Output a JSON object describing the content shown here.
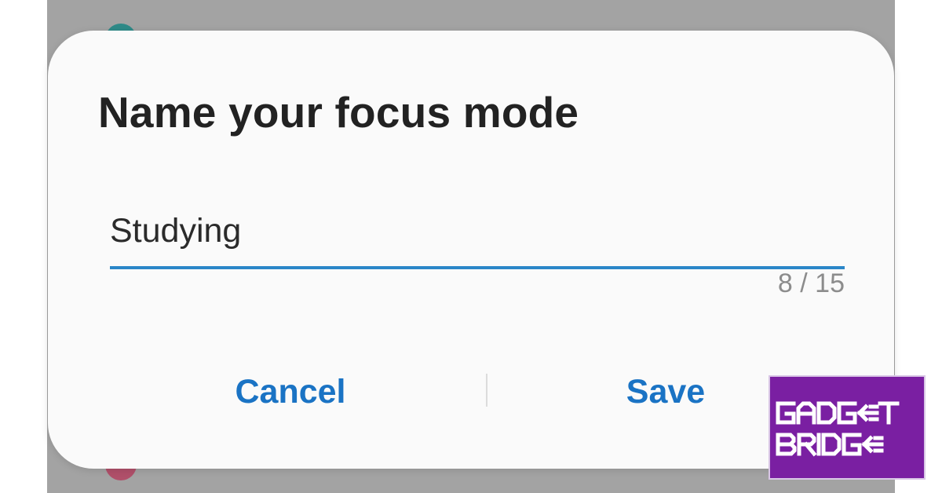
{
  "dialog": {
    "title": "Name your focus mode",
    "name_field": {
      "value": "Studying",
      "char_count": "8 / 15"
    },
    "buttons": {
      "cancel_label": "Cancel",
      "save_label": "Save"
    }
  },
  "watermark": {
    "brand": "GADGET BRIDGE",
    "background_color": "#7a1fa2"
  },
  "colors": {
    "accent": "#1a73c4",
    "field_underline": "#2a86c8",
    "title_text": "#222222",
    "scrim": "#a3a3a3"
  }
}
